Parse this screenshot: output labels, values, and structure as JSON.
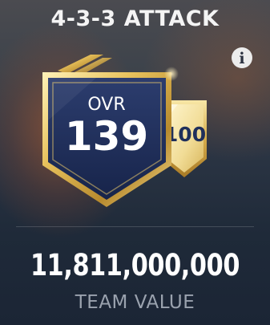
{
  "formation": {
    "title": "4-3-3 ATTACK"
  },
  "info_button": {
    "icon": "info-icon",
    "glyph": "i"
  },
  "rating": {
    "ovr_label": "OVR",
    "ovr_value": "139",
    "secondary_value": "100"
  },
  "team": {
    "value": "11,811,000,000",
    "value_label": "TEAM VALUE"
  },
  "colors": {
    "gold": "#e8c66a",
    "navy": "#1f2f5b",
    "label_gray": "#9aa2ae"
  }
}
